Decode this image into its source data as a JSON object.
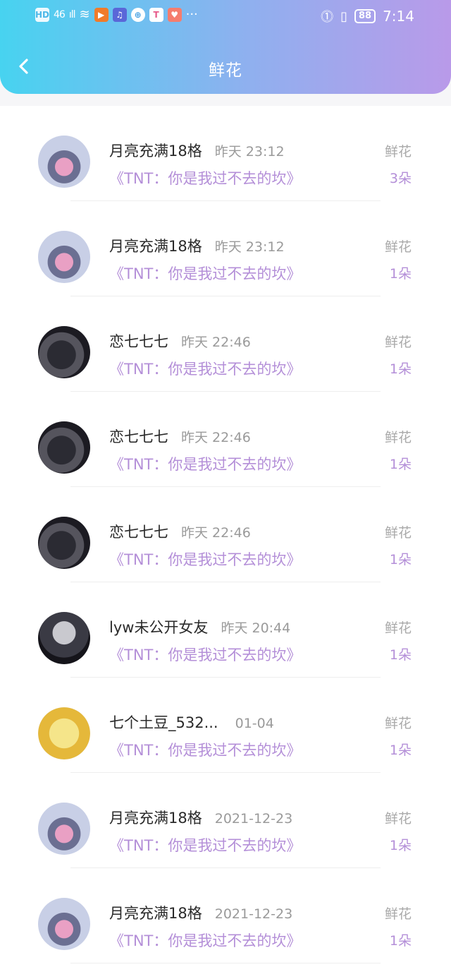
{
  "status_bar": {
    "left": [
      "HD",
      "46",
      "ıll",
      "≋"
    ],
    "apps": [
      "▶",
      "♫",
      "⊕",
      "T",
      "♥"
    ],
    "more": "···",
    "right_icons": [
      "⓵",
      "▯",
      "88"
    ],
    "time": "7:14"
  },
  "header": {
    "title": "鲜花"
  },
  "list": {
    "items": [
      {
        "user": "月亮充满18格",
        "time": "昨天 23:12",
        "work": "《TNT：你是我过不去的坎》",
        "label": "鲜花",
        "count": "3朵"
      },
      {
        "user": "月亮充满18格",
        "time": "昨天 23:12",
        "work": "《TNT：你是我过不去的坎》",
        "label": "鲜花",
        "count": "1朵"
      },
      {
        "user": "恋七七七",
        "time": "昨天 22:46",
        "work": "《TNT：你是我过不去的坎》",
        "label": "鲜花",
        "count": "1朵"
      },
      {
        "user": "恋七七七",
        "time": "昨天 22:46",
        "work": "《TNT：你是我过不去的坎》",
        "label": "鲜花",
        "count": "1朵"
      },
      {
        "user": "恋七七七",
        "time": "昨天 22:46",
        "work": "《TNT：你是我过不去的坎》",
        "label": "鲜花",
        "count": "1朵"
      },
      {
        "user": "lyw未公开女友",
        "time": "昨天 20:44",
        "work": "《TNT：你是我过不去的坎》",
        "label": "鲜花",
        "count": "1朵"
      },
      {
        "user": "七个土豆_532...",
        "time": "01-04",
        "work": "《TNT：你是我过不去的坎》",
        "label": "鲜花",
        "count": "1朵"
      },
      {
        "user": "月亮充满18格",
        "time": "2021-12-23",
        "work": "《TNT：你是我过不去的坎》",
        "label": "鲜花",
        "count": "1朵"
      },
      {
        "user": "月亮充满18格",
        "time": "2021-12-23",
        "work": "《TNT：你是我过不去的坎》",
        "label": "鲜花",
        "count": "1朵"
      }
    ]
  },
  "colors": {
    "gradient_start": "#47d3f0",
    "gradient_end": "#b99ae9",
    "accent_purple": "#b48fd8",
    "muted_gray": "#9a9a9a"
  }
}
